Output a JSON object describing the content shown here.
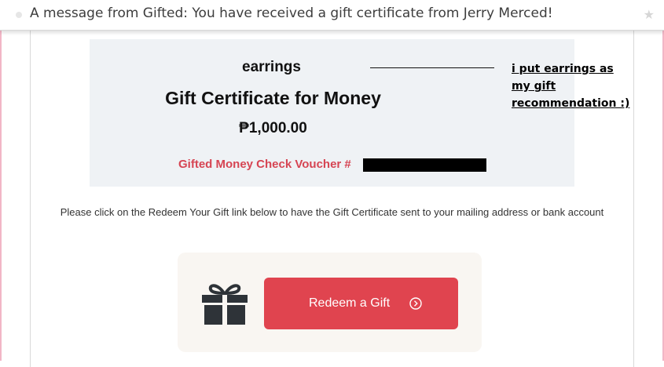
{
  "notification": {
    "message": "A message from Gifted: You have received a gift certificate from Jerry Merced!"
  },
  "certificate": {
    "item": "earrings",
    "title": "Gift Certificate for Money",
    "amount": "₱1,000.00",
    "voucher_label": "Gifted Money Check Voucher #"
  },
  "annotation": {
    "lines": [
      "i put earrings as ",
      "my gift ",
      "recommendation :)"
    ]
  },
  "instructions": "Please click on the Redeem Your Gift link below to have the Gift Certificate sent to your mailing address or bank account",
  "redeem": {
    "button_label": "Redeem a Gift"
  },
  "colors": {
    "accent": "#e0444f",
    "voucher_text": "#d64553",
    "certificate_bg": "#eff2f5"
  },
  "icons": [
    "gift-icon",
    "arrow-right-circle-icon",
    "star-icon"
  ]
}
